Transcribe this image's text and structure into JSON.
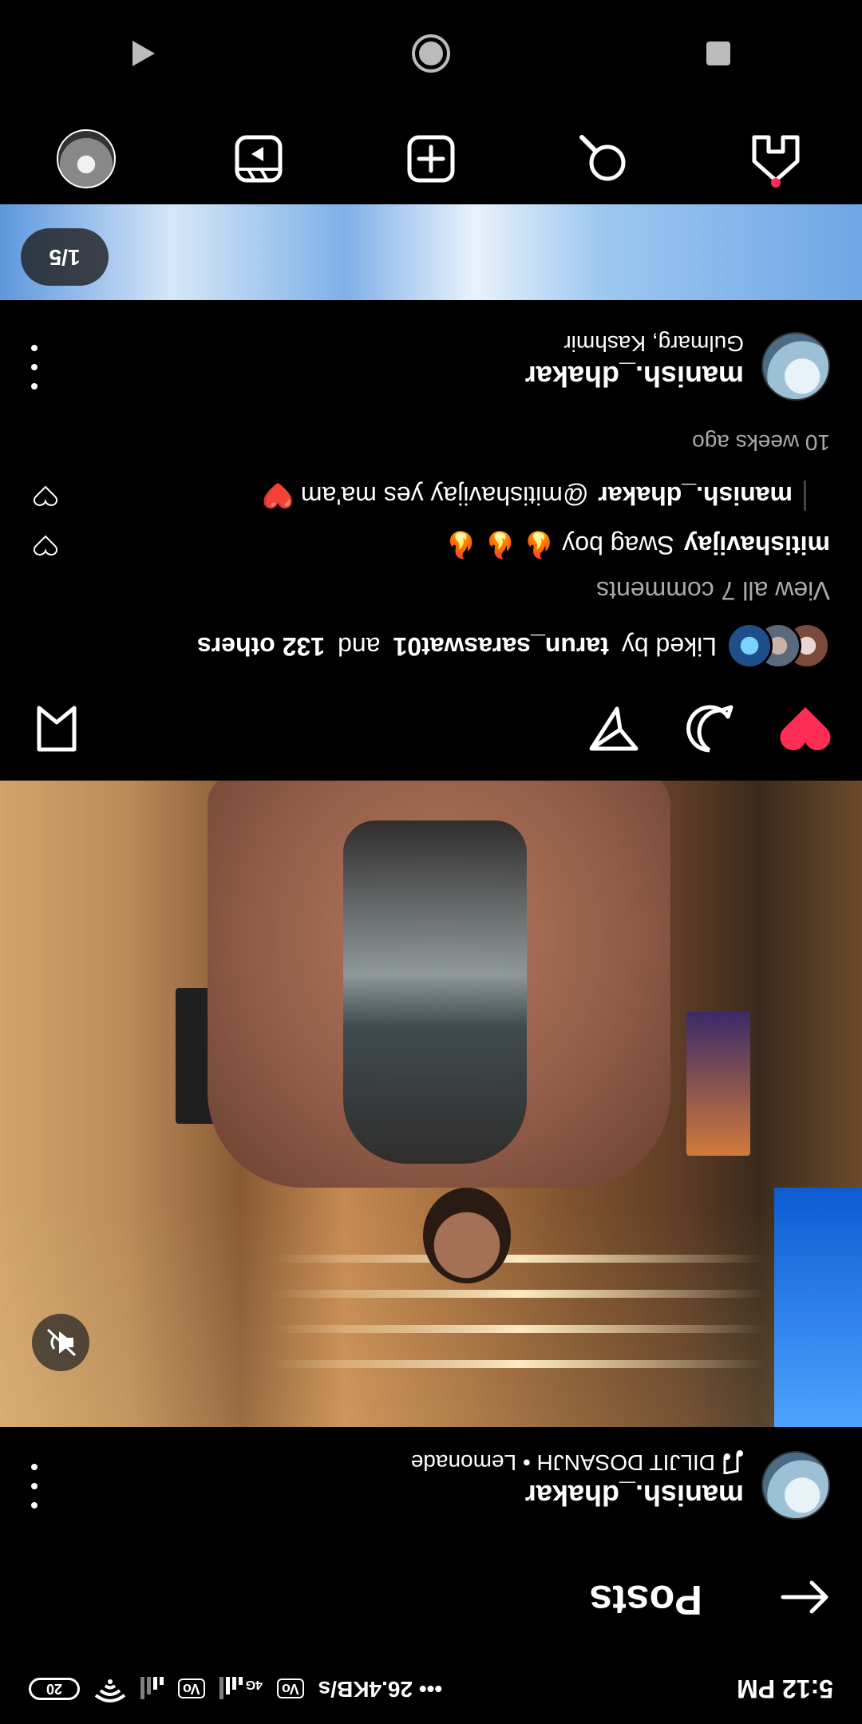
{
  "status": {
    "time": "5:12 PM",
    "speed": "26.4KB/s",
    "vo1": "Vo",
    "net": "4G",
    "vo2": "Vo",
    "battery": "20"
  },
  "header": {
    "title": "Posts"
  },
  "post": {
    "username": "manish._dhakar",
    "audio": "DILJIT DOSANJH • Lemonade",
    "likes_text": "Liked by",
    "liked_user": "tarun_saraswat01",
    "likes_and": "and",
    "likes_others": "132 others",
    "view_all": "View all 7 comments",
    "comments": [
      {
        "user": "mitishavijay",
        "text": "Swag boy 🔥 🔥 🔥"
      },
      {
        "user": "manish._dhakar",
        "text": "@mitishavijay yes ma'am ❤️"
      }
    ],
    "time_ago": "10 weeks ago"
  },
  "post2": {
    "username": "manish._dhakar",
    "location": "Gulmarg, Kashmir",
    "counter": "1/5"
  },
  "icons": {
    "back": "arrow-left-icon",
    "more": "more-vertical-icon",
    "music": "music-note-icon",
    "mute": "speaker-muted-icon",
    "like": "heart-filled-icon",
    "comment": "comment-icon",
    "share": "send-icon",
    "save": "bookmark-icon",
    "home": "home-icon",
    "search": "search-icon",
    "create": "plus-square-icon",
    "reels": "reels-icon",
    "profile": "profile-avatar"
  },
  "colors": {
    "like": "#ff2d55",
    "muted_text": "#aaaaaa"
  }
}
